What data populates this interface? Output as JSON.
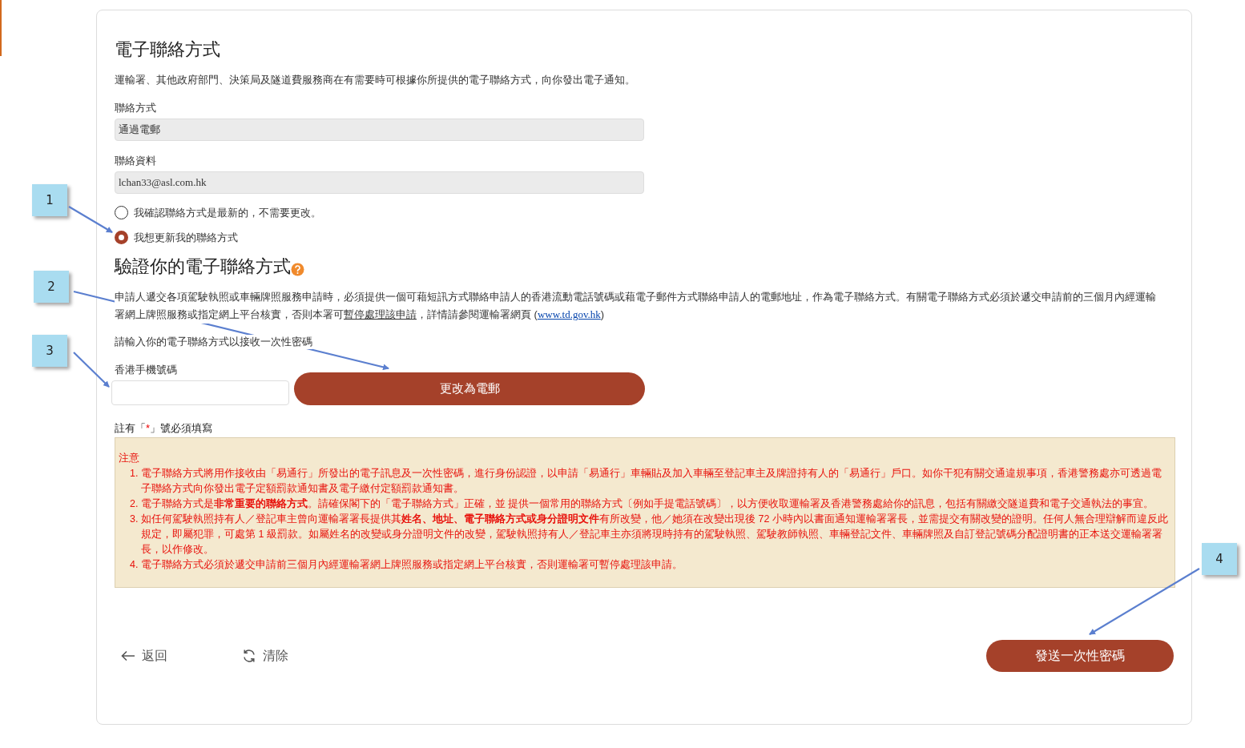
{
  "contact_section": {
    "title": "電子聯絡方式",
    "description": "運輸署、其他政府部門、決策局及隧道費服務商在有需要時可根據你所提供的電子聯絡方式，向你發出電子通知。",
    "fields": [
      {
        "label": "聯絡方式",
        "value": "通過電郵"
      },
      {
        "label": "聯絡資料",
        "value": "lchan33@asl.com.hk"
      }
    ],
    "options": [
      {
        "label": "我確認聯絡方式是最新的，不需要更改。",
        "selected": false
      },
      {
        "label": "我想更新我的聯絡方式",
        "selected": true
      }
    ]
  },
  "verify_section": {
    "title": "驗證你的電子聯絡方式",
    "paragraph_start": "申請人遞交各項駕駛執照或車輛牌照服務申請時，必須提供一個可藉短訊方式聯絡申請人的香港流動電話號碼或藉電子郵件方式聯絡申請人的電郵地址，作為電子聯絡方式。有關電子聯絡方式必須於遞交申請前的三個月內經運輸署網上牌照服務或指定網上平台核實，否則本署可",
    "paragraph_underlined": "暫停處理該申請",
    "paragraph_mid": "，詳情請參閱運輸署網頁 (",
    "link": "www.td.gov.hk",
    "paragraph_end": ")",
    "prompt": "請輸入你的電子聯絡方式以接收一次性密碼",
    "phone_label": "香港手機號碼",
    "switch_button": "更改為電郵"
  },
  "required_note": {
    "before": "註有「",
    "mark": "*",
    "after": "」號必須填寫"
  },
  "notice": {
    "title": "注意",
    "items": [
      {
        "number": "1.",
        "text": "電子聯絡方式將用作接收由「易通行」所發出的電子訊息及一次性密碼，進行身份認證，以申請「易通行」車輛貼及加入車輛至登記車主及牌證持有人的「易通行」戶口。如你干犯有關交通違規事項，香港警務處亦可透過電子聯絡方式向你發出電子定額罰款通知書及電子繳付定額罰款通知書。"
      },
      {
        "number": "2.",
        "text": "電子聯絡方式是**非常重要的聯絡方式**。請確保閣下的「電子聯絡方式」正確，並 提供一個常用的聯絡方式〔例如手提電話號碼〕，以方便收取運輸署及香港警務處給你的訊息，包括有關繳交隧道費和電子交通執法的事宜。"
      },
      {
        "number": "3.",
        "text": "如任何駕駛執照持有人／登記車主曾向運輸署署長提供其**姓名、地址、電子聯絡方式或身分證明文件**有所改變，他／她須在改變出現後 72 小時內以書面通知運輸署署長，並需提交有關改變的證明。任何人無合理辯解而違反此規定，即屬犯罪，可處第 1 級罰款。如屬姓名的改變或身分證明文件的改變，駕駛執照持有人／登記車主亦須將現時持有的駕駛執照、駕駛教師執照、車輛登記文件、車輛牌照及自訂登記號碼分配證明書的正本送交運輸署署長，以作修改。"
      },
      {
        "number": "4.",
        "text": "電子聯絡方式必須於遞交申請前三個月內經運輸署網上牌照服務或指定網上平台核實，否則運輸署可暫停處理該申請。"
      }
    ]
  },
  "footer": {
    "back": "返回",
    "clear": "清除",
    "send": "發送一次性密碼"
  },
  "callouts": [
    "1",
    "2",
    "3",
    "4"
  ]
}
